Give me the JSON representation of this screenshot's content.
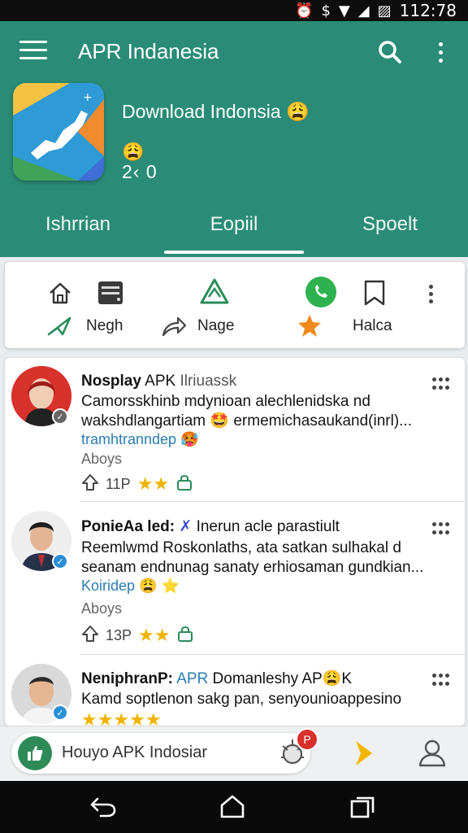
{
  "status_bar": {
    "time": "112:78"
  },
  "app_bar": {
    "title": "APR Indanesia"
  },
  "app_info": {
    "name": "Download Indonsia 😩",
    "emoji": "😩",
    "stats": "2‹  0"
  },
  "tabs": [
    {
      "label": "Ishrrian"
    },
    {
      "label": "Eopiil"
    },
    {
      "label": "Spoelt"
    }
  ],
  "toolbar": {
    "labels": [
      "Negh",
      "Nage",
      "Halca"
    ]
  },
  "posts": [
    {
      "author": "Nosplay",
      "tag": "APK",
      "subtitle": "Ilriuassk",
      "line1": "Camorsskhinb mdynioan alechlenidska nd",
      "line2": "wakshdlangartiam 🤩 ermemichasaukand(inrl)...",
      "link": "tramhtranndep 🥵",
      "meta": "Aboys",
      "count": "11P"
    },
    {
      "author": "PonieAa led:",
      "tag": "Inerun acle parastiult",
      "line1": "Reemlwmd Roskonlaths, ata satkan sulhakal d",
      "line2": "seanam endnunag sanaty erhiosaman gundkian...",
      "link": "Koiridep 😩 ⭐",
      "meta": "Aboys",
      "count": "13P"
    },
    {
      "author": "NeniphranP:",
      "tag": "APR",
      "subtitle": "Domanleshy AP😩K",
      "line1": "Kamd soptlenon sakg pan, senyounioappesino"
    }
  ],
  "bottom_bar": {
    "text": "Houyo APK Indosiar",
    "notification_badge": "P"
  }
}
